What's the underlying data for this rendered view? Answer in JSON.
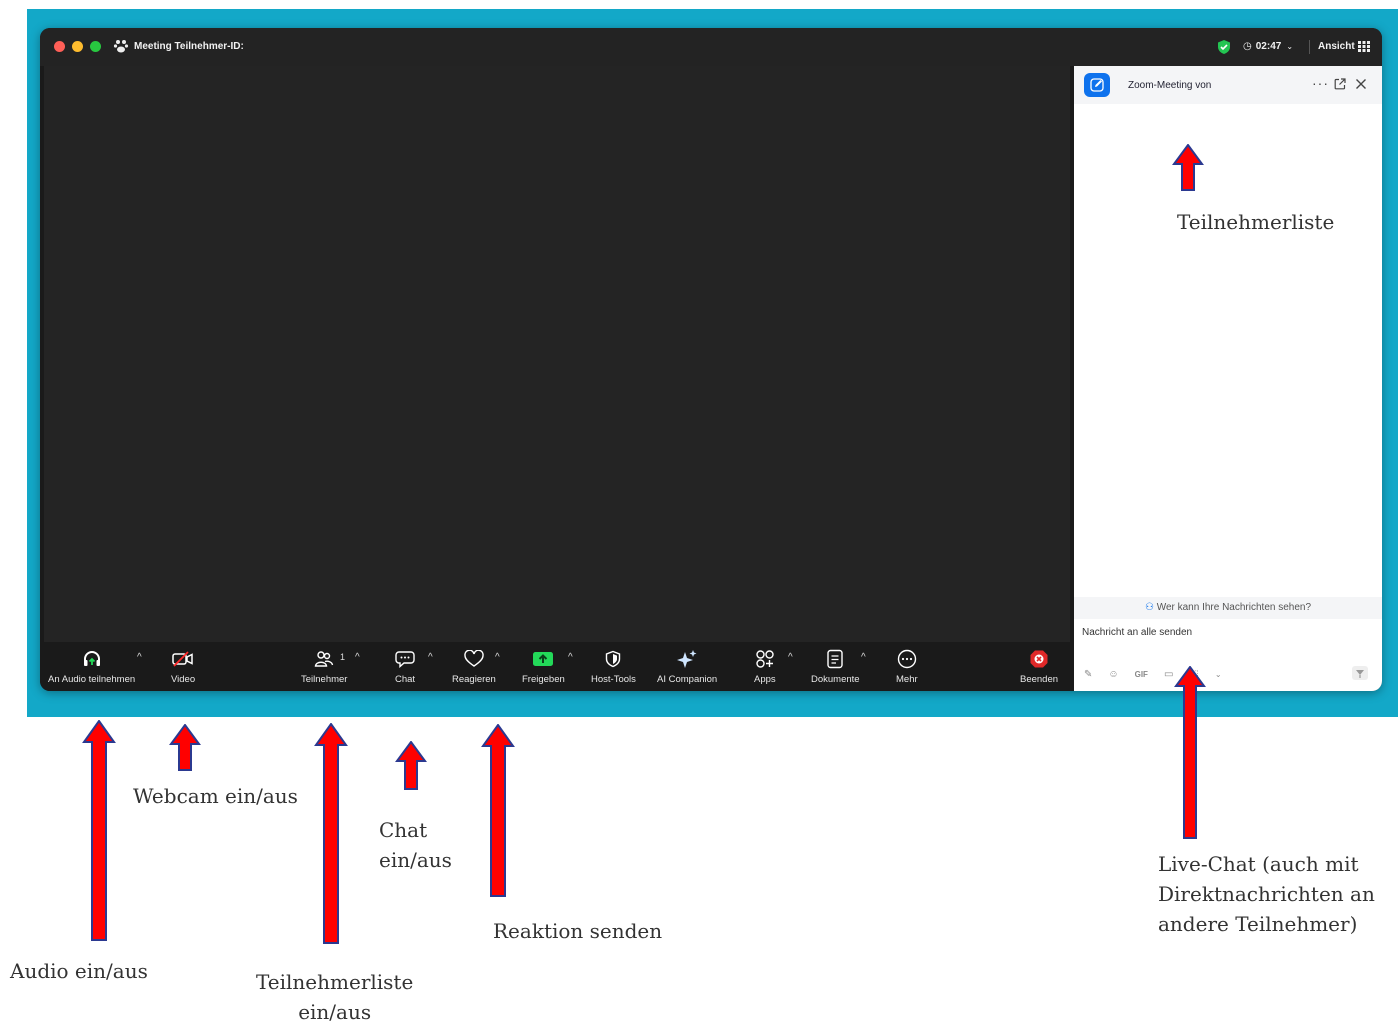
{
  "window": {
    "title": "Meeting Teilnehmer-ID:",
    "timer": "02:47",
    "view_label": "Ansicht"
  },
  "toolbar": {
    "audio_label": "An Audio teilnehmen",
    "video_label": "Video",
    "participants_label": "Teilnehmer",
    "participants_count": "1",
    "chat_label": "Chat",
    "react_label": "Reagieren",
    "share_label": "Freigeben",
    "host_tools_label": "Host-Tools",
    "ai_label": "AI Companion",
    "apps_label": "Apps",
    "docs_label": "Dokumente",
    "more_label": "Mehr",
    "end_label": "Beenden"
  },
  "chat_panel": {
    "title": "Zoom-Meeting von",
    "who_can_see": "Wer kann Ihre Nachrichten sehen?",
    "input_placeholder": "Nachricht an alle senden",
    "gif_label": "GIF"
  },
  "annotations": {
    "participants_list": "Teilnehmerliste",
    "webcam": "Webcam ein/aus",
    "chat_line1": "Chat",
    "chat_line2": "ein/aus",
    "audio": "Audio ein/aus",
    "participants_toggle_line1": "Teilnehmerliste",
    "participants_toggle_line2": "ein/aus",
    "reaction": "Reaktion senden",
    "livechat_line1": "Live-Chat (auch mit",
    "livechat_line2": "Direktnachrichten an",
    "livechat_line3": "andere Teilnehmer)"
  },
  "colors": {
    "background_teal": "#13a8c8",
    "accent_blue": "#0e72ed",
    "share_green": "#23d959",
    "end_red": "#e02828",
    "arrow_red": "#ff0000",
    "arrow_outline": "#2b3990"
  }
}
